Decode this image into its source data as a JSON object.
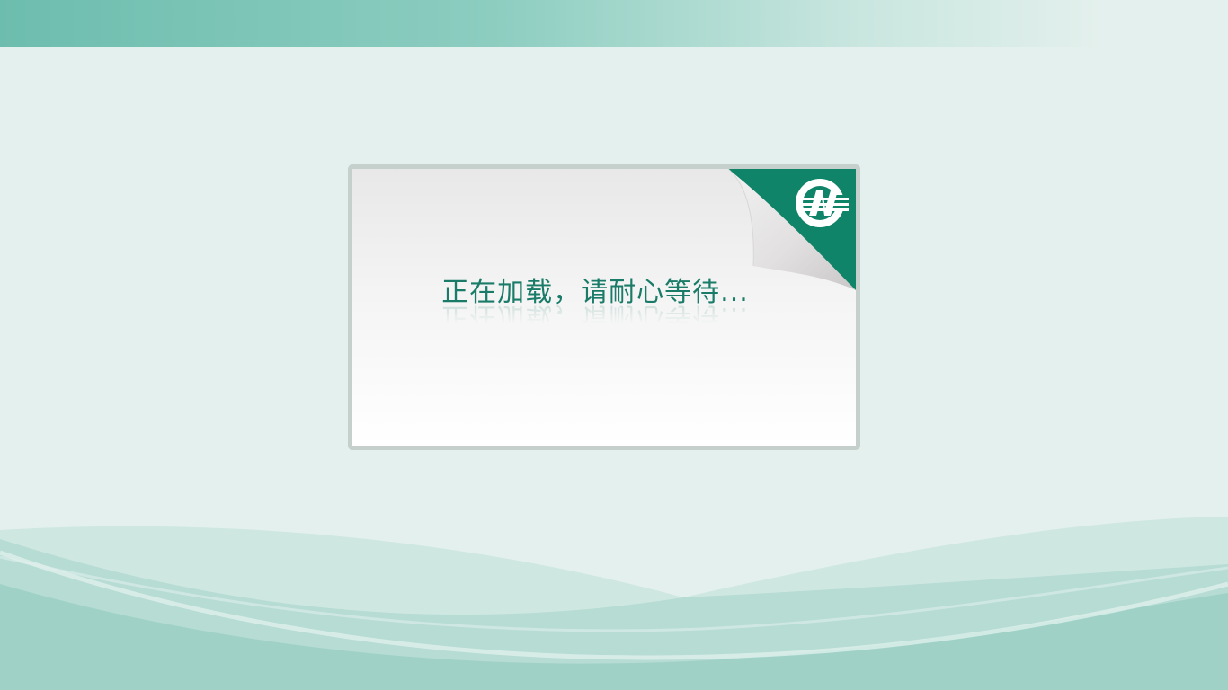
{
  "loading": {
    "message": "正在加载，请耐心等待..."
  },
  "icons": {
    "logo": "cn-logo-icon",
    "page_curl": "page-curl-icon"
  },
  "colors": {
    "accent": "#0f8468",
    "text": "#1a7c68",
    "top_bar_start": "#6dbdae",
    "background": "#e4f0ed",
    "dialog_border": "#c5cfcc",
    "wave_dark": "#9ccfc5",
    "wave_light": "#c2e2db"
  }
}
